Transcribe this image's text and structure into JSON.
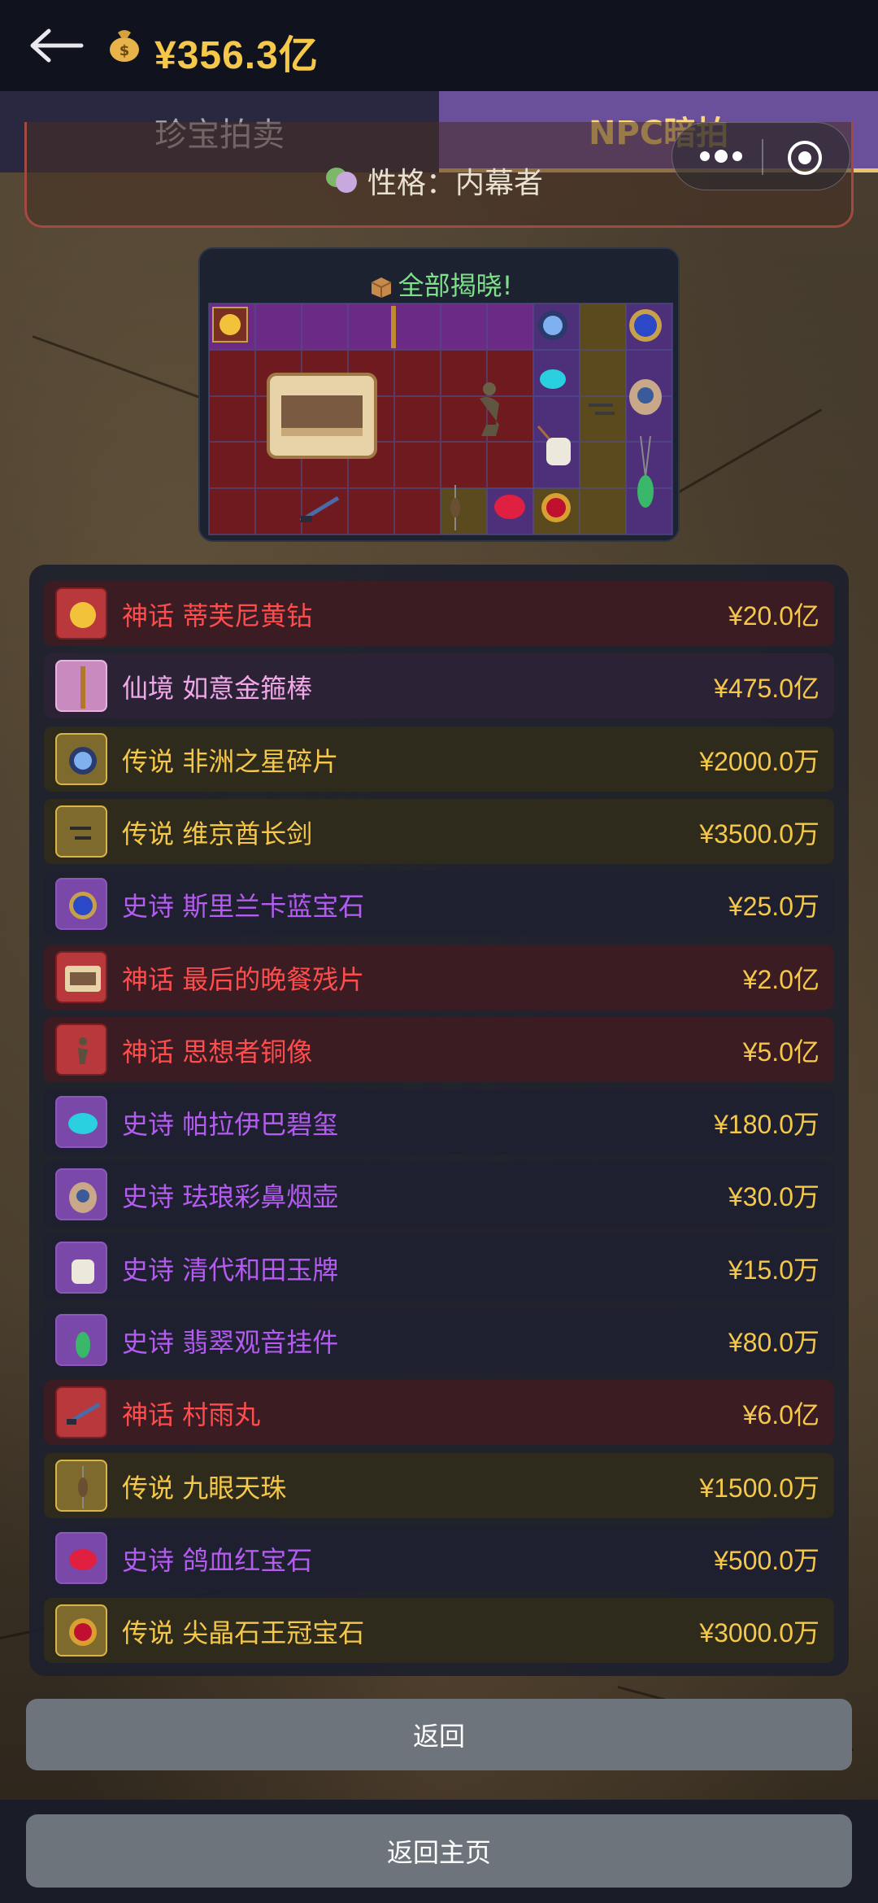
{
  "header": {
    "money": "¥356.3亿",
    "money_icon": "money-bag-icon",
    "back_icon": "arrow-left-icon"
  },
  "tabs": [
    {
      "label": "珍宝拍卖",
      "active": false
    },
    {
      "label": "NPC暗拍",
      "active": true
    }
  ],
  "persona": {
    "text": "性格：内幕者",
    "icon": "mask-icon"
  },
  "reveal": {
    "title": "全部揭晓!",
    "icon": "box-icon"
  },
  "colors": {
    "myth": "#ff4d4d",
    "fairy": "#f0a8e8",
    "legend": "#f5c84a",
    "epic": "#b45cf0",
    "price": "#f5c84a"
  },
  "items": [
    {
      "rarity": "神话",
      "name": "蒂芙尼黄钻",
      "price": "¥20.0亿",
      "tier": "myth",
      "icon": "yellow-diamond-icon"
    },
    {
      "rarity": "仙境",
      "name": "如意金箍棒",
      "price": "¥475.0亿",
      "tier": "fairy",
      "icon": "golden-staff-icon"
    },
    {
      "rarity": "传说",
      "name": "非洲之星碎片",
      "price": "¥2000.0万",
      "tier": "legend",
      "icon": "blue-diamond-icon"
    },
    {
      "rarity": "传说",
      "name": "维京酋长剑",
      "price": "¥3500.0万",
      "tier": "legend",
      "icon": "sword-icon"
    },
    {
      "rarity": "史诗",
      "name": "斯里兰卡蓝宝石",
      "price": "¥25.0万",
      "tier": "epic",
      "icon": "sapphire-icon"
    },
    {
      "rarity": "神话",
      "name": "最后的晚餐残片",
      "price": "¥2.0亿",
      "tier": "myth",
      "icon": "painting-icon"
    },
    {
      "rarity": "神话",
      "name": "思想者铜像",
      "price": "¥5.0亿",
      "tier": "myth",
      "icon": "statue-icon"
    },
    {
      "rarity": "史诗",
      "name": "帕拉伊巴碧玺",
      "price": "¥180.0万",
      "tier": "epic",
      "icon": "tourmaline-icon"
    },
    {
      "rarity": "史诗",
      "name": "珐琅彩鼻烟壶",
      "price": "¥30.0万",
      "tier": "epic",
      "icon": "snuff-bottle-icon"
    },
    {
      "rarity": "史诗",
      "name": "清代和田玉牌",
      "price": "¥15.0万",
      "tier": "epic",
      "icon": "jade-tablet-icon"
    },
    {
      "rarity": "史诗",
      "name": "翡翠观音挂件",
      "price": "¥80.0万",
      "tier": "epic",
      "icon": "jade-pendant-icon"
    },
    {
      "rarity": "神话",
      "name": "村雨丸",
      "price": "¥6.0亿",
      "tier": "myth",
      "icon": "katana-icon"
    },
    {
      "rarity": "传说",
      "name": "九眼天珠",
      "price": "¥1500.0万",
      "tier": "legend",
      "icon": "bead-icon"
    },
    {
      "rarity": "史诗",
      "name": "鸽血红宝石",
      "price": "¥500.0万",
      "tier": "epic",
      "icon": "ruby-icon"
    },
    {
      "rarity": "传说",
      "name": "尖晶石王冠宝石",
      "price": "¥3000.0万",
      "tier": "legend",
      "icon": "spinel-icon"
    }
  ],
  "buttons": {
    "return": "返回",
    "home": "返回主页"
  }
}
